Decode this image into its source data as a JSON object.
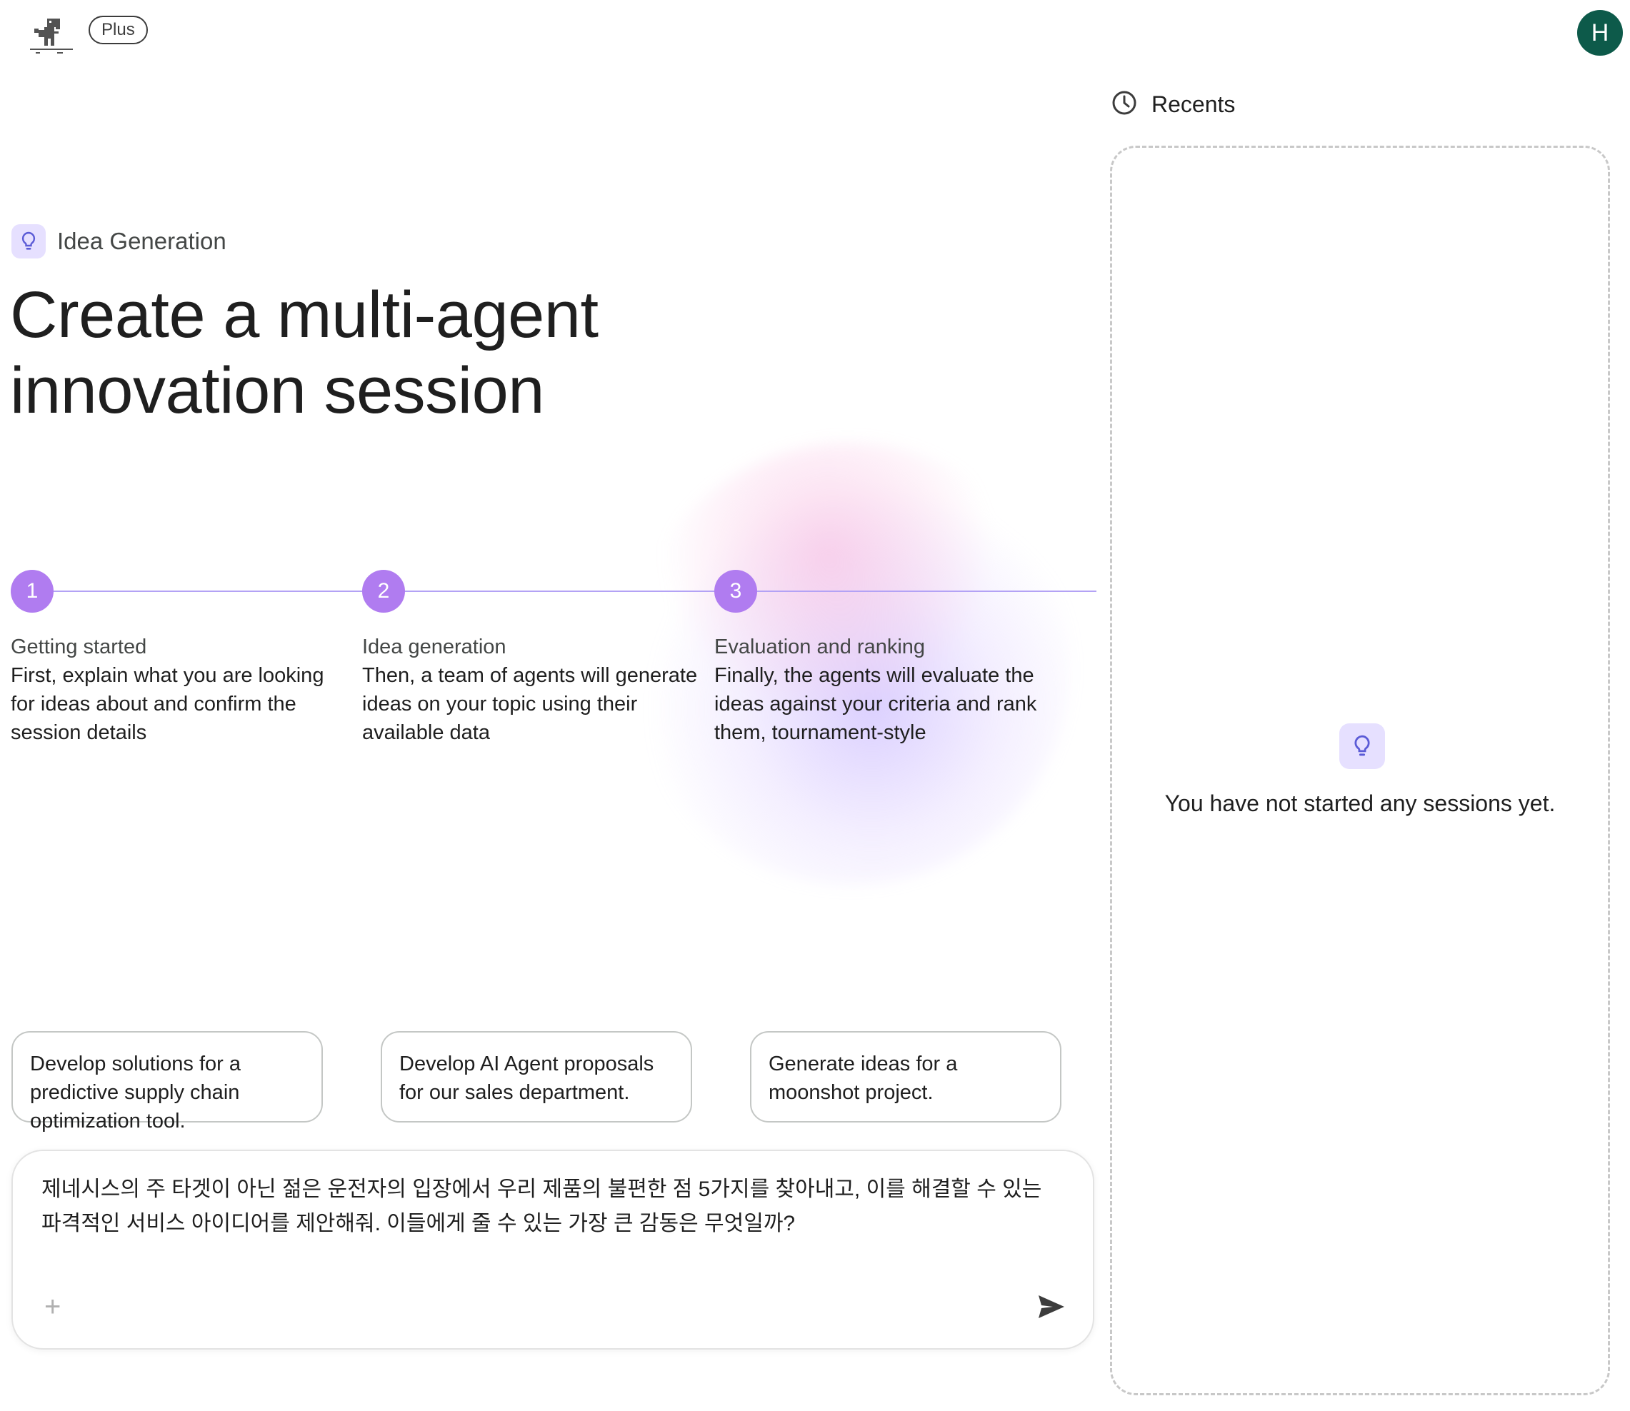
{
  "header": {
    "plan_badge": "Plus",
    "avatar_initial": "H"
  },
  "main": {
    "category_label": "Idea Generation",
    "headline_line1": "Create a multi-agent",
    "headline_line2": "innovation session",
    "steps": [
      {
        "number": "1",
        "title": "Getting started",
        "description": "First, explain what you are looking for ideas about and confirm the session details"
      },
      {
        "number": "2",
        "title": "Idea generation",
        "description": "Then, a team of agents will generate ideas on your topic using their available data"
      },
      {
        "number": "3",
        "title": "Evaluation and ranking",
        "description": "Finally, the agents will evaluate the ideas against your criteria and rank them, tournament-style"
      }
    ],
    "suggestions": [
      "Develop solutions for a predictive supply chain optimization tool.",
      "Develop AI Agent proposals for our sales department.",
      "Generate ideas for a moonshot project."
    ],
    "prompt": {
      "line1": "제네시스의 주 타겟이 아닌 젊은 운전자의 입장에서 우리 제품의 불편한 점 5가지를 찾아내고, 이를 해결할 수 있는",
      "line2": "파격적인 서비스 아이디어를 제안해줘. 이들에게 줄 수 있는 가장 큰 감동은 무엇일까?",
      "add_icon": "plus-icon",
      "send_icon": "send-icon"
    }
  },
  "recents": {
    "title": "Recents",
    "empty_message": "You have not started any sessions yet."
  },
  "colors": {
    "accent": "#b07cf0",
    "accent_light": "#e6e0ff",
    "avatar_bg": "#0d5a4a"
  }
}
